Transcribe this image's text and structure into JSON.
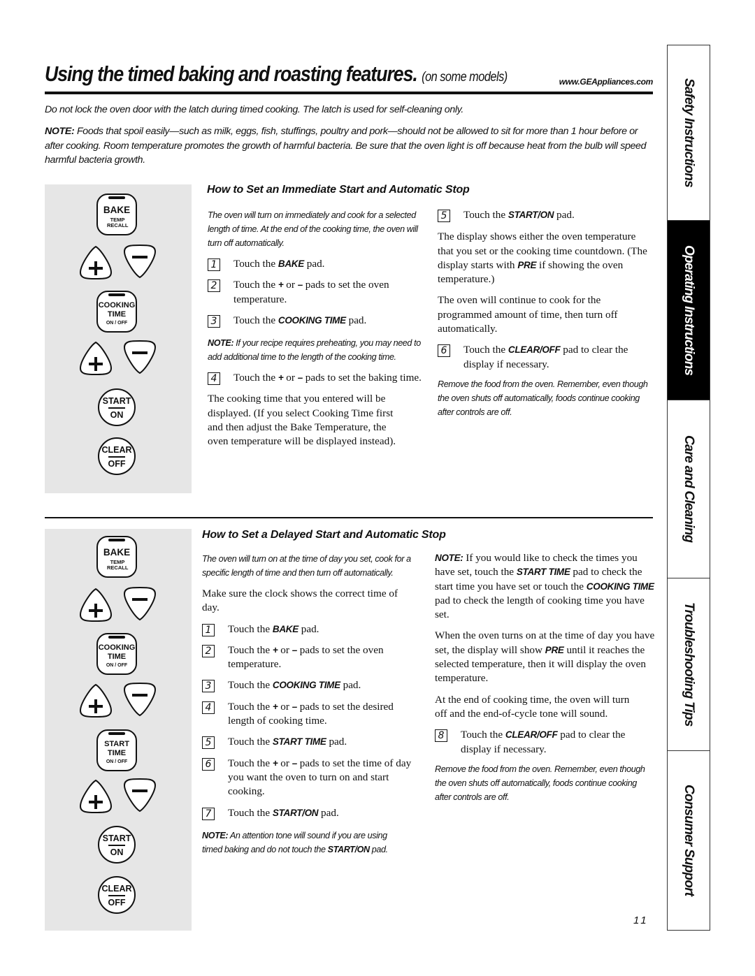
{
  "header": {
    "title": "Using the timed baking and roasting features.",
    "subtitle": "(on some models)",
    "website": "www.GEAppliances.com"
  },
  "intro": {
    "latch_warning": "Do not lock the oven door with the latch during timed cooking. The latch is used for self-cleaning only.",
    "note_label": "NOTE:",
    "note_text": " Foods that spoil easily—such as milk, eggs, fish, stuffings, poultry and pork—should not be allowed to sit for more than 1 hour before or after cooking. Room temperature promotes the growth of harmful bacteria. Be sure that the oven light is off because heat from the bulb will speed harmful bacteria growth."
  },
  "keypads": {
    "bake": {
      "label": "BAKE",
      "sub": "TEMP RECALL"
    },
    "cooking_time": {
      "line1": "COOKING",
      "line2": "TIME",
      "sub": "ON / OFF"
    },
    "start_time": {
      "line1": "START",
      "line2": "TIME",
      "sub": "ON / OFF"
    },
    "start_on": {
      "top": "START",
      "bottom": "ON"
    },
    "clear_off": {
      "top": "CLEAR",
      "bottom": "OFF"
    },
    "plus": "+",
    "minus": "−"
  },
  "section1": {
    "heading": "How to Set an Immediate Start and Automatic Stop",
    "intro": "The oven will turn on immediately and cook for a selected length of time. At the end of the cooking time, the oven will turn off automatically.",
    "steps": [
      {
        "num": "1",
        "pre": "Touch the ",
        "bold": "BAKE",
        "post": " pad."
      },
      {
        "num": "2",
        "pre": "Touch the ",
        "bold": "+",
        "mid": " or ",
        "bold2": "–",
        "post": " pads to set the oven temperature."
      },
      {
        "num": "3",
        "pre": "Touch the ",
        "bold": "COOKING TIME",
        "post": " pad."
      },
      {
        "num": "4",
        "pre": "Touch the ",
        "bold": "+",
        "mid": " or ",
        "bold2": "–",
        "post": " pads to set the baking time."
      },
      {
        "num": "5",
        "pre": "Touch the ",
        "bold": "START/ON",
        "post": " pad."
      },
      {
        "num": "6",
        "pre": "Touch the ",
        "bold": "CLEAR/OFF",
        "post": " pad to clear the display if necessary."
      }
    ],
    "note_label": "NOTE:",
    "note_text": " If your recipe requires preheating, you may need to add additional time to the length of the cooking time.",
    "after_step4": "The cooking time that you entered will be displayed. (If you select Cooking Time first and then adjust the Bake Temperature, the oven temperature will be displayed instead).",
    "display_pre": "The display shows either the oven temperature that you set or the cooking time countdown. (The display starts with ",
    "display_bold": "PRE",
    "display_post": " if showing the oven temperature.)",
    "continue_text": "The oven will continue to cook for the programmed amount of time, then turn off automatically.",
    "remove_text": "Remove the food from the oven. Remember, even though the oven shuts off automatically, foods continue cooking after controls are off."
  },
  "section2": {
    "heading": "How to Set a Delayed Start and Automatic Stop",
    "intro": "The oven will turn on at the time of day you set, cook for a specific length of time and then turn off automatically.",
    "clock_text": "Make sure the clock shows the correct time of day.",
    "steps": [
      {
        "num": "1",
        "pre": "Touch the ",
        "bold": "BAKE",
        "post": " pad."
      },
      {
        "num": "2",
        "pre": "Touch the ",
        "bold": "+",
        "mid": " or ",
        "bold2": "–",
        "post": " pads to set the oven temperature."
      },
      {
        "num": "3",
        "pre": "Touch the ",
        "bold": "COOKING TIME",
        "post": " pad."
      },
      {
        "num": "4",
        "pre": "Touch the ",
        "bold": "+",
        "mid": " or ",
        "bold2": "–",
        "post": " pads to set the desired length of cooking time."
      },
      {
        "num": "5",
        "pre": "Touch the ",
        "bold": "START TIME",
        "post": " pad."
      },
      {
        "num": "6",
        "pre": "Touch the ",
        "bold": "+",
        "mid": " or ",
        "bold2": "–",
        "post": " pads to set the time of day you want the oven to turn on and start cooking."
      },
      {
        "num": "7",
        "pre": "Touch the ",
        "bold": "START/ON",
        "post": " pad."
      },
      {
        "num": "8",
        "pre": "Touch the ",
        "bold": "CLEAR/OFF",
        "post": " pad to clear the display if necessary."
      }
    ],
    "note1_label": "NOTE:",
    "note1_pre": " An attention tone will sound if you are using timed baking and do not touch the ",
    "note1_bold": "START/ON",
    "note1_post": " pad.",
    "note2_label": "NOTE:",
    "note2_pre": " If you would like to check the times you have set, touch the ",
    "note2_bold1": "START TIME",
    "note2_mid": " pad to check the start time you have set or touch the ",
    "note2_bold2": "COOKING TIME",
    "note2_post": " pad to check the length of cooking time you have set.",
    "turn_on_pre": "When the oven turns on at the time of day you have set, the display will show ",
    "turn_on_bold": "PRE",
    "turn_on_post": " until it reaches the selected temperature, then it will display the oven temperature.",
    "end_text": "At the end of cooking time, the oven will turn off and the end-of-cycle tone will sound.",
    "remove_text": "Remove the food from the oven. Remember, even though the oven shuts off automatically, foods continue cooking after controls are off."
  },
  "sidebar": {
    "tabs": [
      {
        "label": "Safety Instructions",
        "active": false
      },
      {
        "label": "Operating Instructions",
        "active": true
      },
      {
        "label": "Care and Cleaning",
        "active": false
      },
      {
        "label": "Troubleshooting Tips",
        "active": false
      },
      {
        "label": "Consumer Support",
        "active": false
      }
    ]
  },
  "footer": {
    "page_number": "11"
  }
}
